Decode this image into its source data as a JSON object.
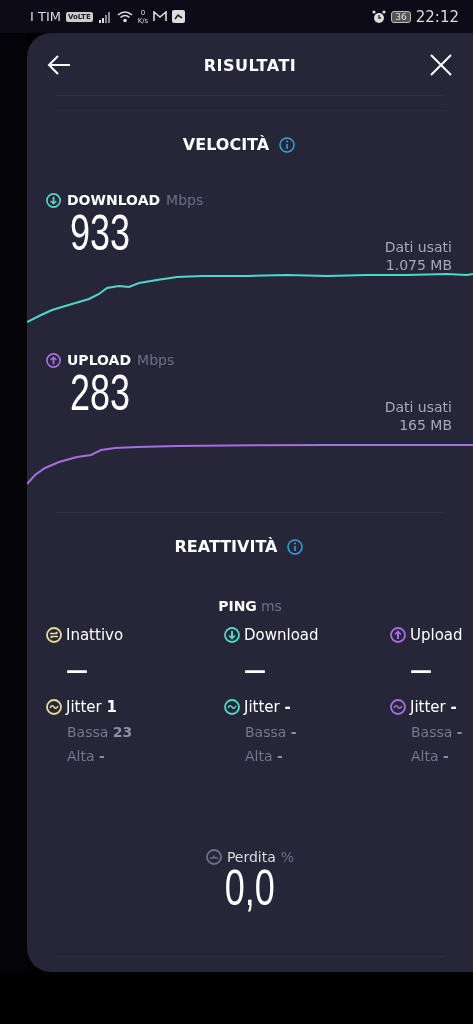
{
  "status_bar": {
    "carrier": "I TIM",
    "network_badge": "VoLTE",
    "speed_value": "0",
    "speed_unit": "K/s",
    "battery": "36",
    "time": "22:12"
  },
  "header": {
    "title": "RISULTATI"
  },
  "speed": {
    "title": "VELOCITÀ",
    "metrics": [
      {
        "kind": "download",
        "label": "DOWNLOAD",
        "unit": "Mbps",
        "value": "933",
        "data_label": "Dati usati",
        "data_value": "1.075 MB",
        "color": "#4fd8c8"
      },
      {
        "kind": "upload",
        "label": "UPLOAD",
        "unit": "Mbps",
        "value": "283",
        "data_label": "Dati usati",
        "data_value": "165 MB",
        "color": "#a66ee0"
      }
    ]
  },
  "responsiveness": {
    "title": "REATTIVITÀ",
    "ping_label": "PING",
    "ping_unit": "ms",
    "columns": [
      {
        "kind": "idle",
        "label": "Inattivo",
        "value": "—",
        "jitter_label": "Jitter",
        "jitter_value": "1",
        "low_label": "Bassa",
        "low_value": "23",
        "high_label": "Alta",
        "high_value": "-",
        "color": "#e6dc9a"
      },
      {
        "kind": "download",
        "label": "Download",
        "value": "—",
        "jitter_label": "Jitter",
        "jitter_value": "-",
        "low_label": "Bassa",
        "low_value": "-",
        "high_label": "Alta",
        "high_value": "-",
        "color": "#4fd8c8"
      },
      {
        "kind": "upload",
        "label": "Upload",
        "value": "—",
        "jitter_label": "Jitter",
        "jitter_value": "-",
        "low_label": "Bassa",
        "low_value": "-",
        "high_label": "Alta",
        "high_value": "-",
        "color": "#a66ee0"
      }
    ],
    "loss": {
      "label": "Perdita",
      "unit": "%",
      "value": "0,0"
    }
  }
}
